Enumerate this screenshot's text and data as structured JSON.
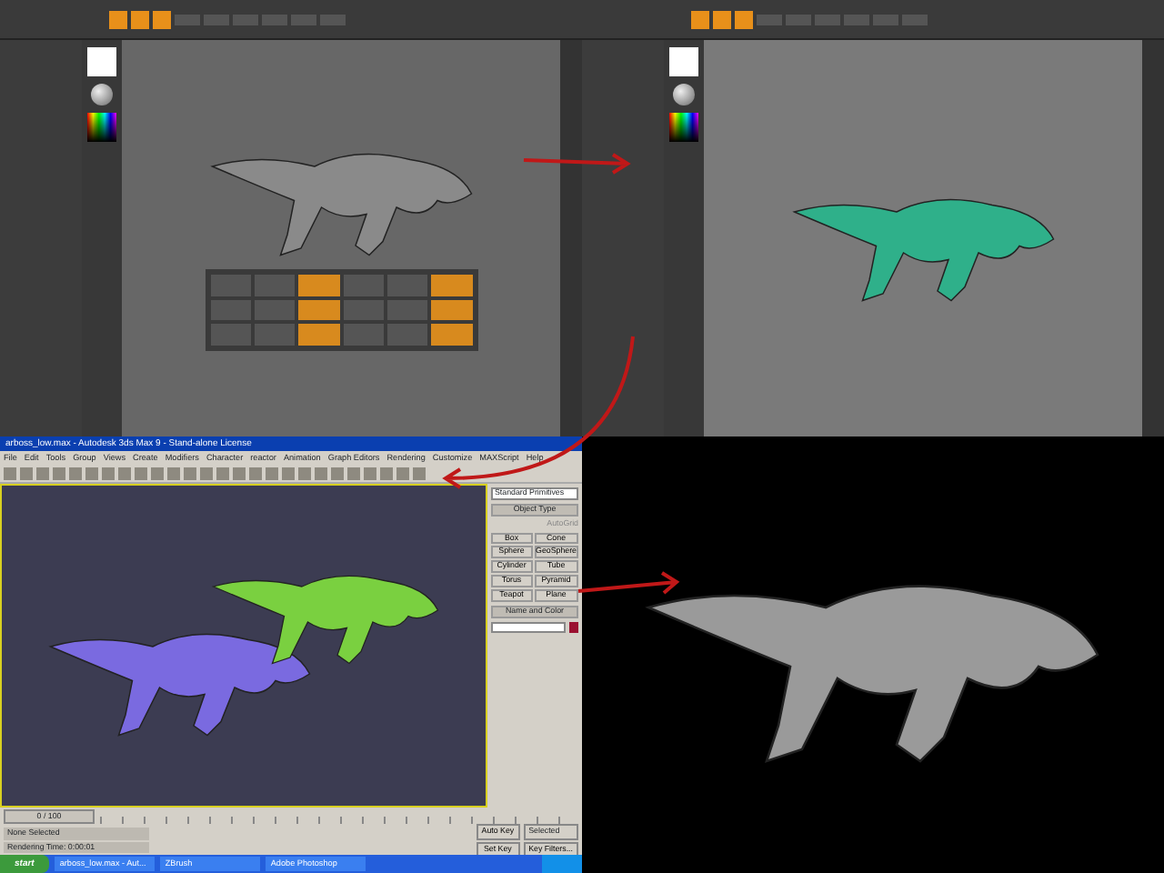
{
  "panels": [
    {
      "kind": "zbrush_sculpt"
    },
    {
      "kind": "zbrush_paint"
    },
    {
      "kind": "max",
      "title": "arboss_low.max - Autodesk 3ds Max 9 - Stand-alone License",
      "menu": [
        "File",
        "Edit",
        "Tools",
        "Group",
        "Views",
        "Create",
        "Modifiers",
        "Character",
        "reactor",
        "Animation",
        "Graph Editors",
        "Rendering",
        "Customize",
        "MAXScript",
        "Help"
      ],
      "command_panel": {
        "dropdown": "Standard Primitives",
        "section": "Object Type",
        "autogrid": "AutoGrid",
        "buttons": [
          "Box",
          "Cone",
          "Sphere",
          "GeoSphere",
          "Cylinder",
          "Tube",
          "Torus",
          "Pyramid",
          "Teapot",
          "Plane"
        ],
        "name_section": "Name and Color"
      },
      "timeline": {
        "label": "0 / 100"
      },
      "status": {
        "selection": "None Selected",
        "render_time": "Rendering Time: 0:00:01",
        "auto_key": "Auto Key",
        "key_mode": "Selected",
        "set_key": "Set Key",
        "key_filters": "Key Filters..."
      },
      "taskbar": {
        "start": "start",
        "tasks": [
          "arboss_low.max - Aut...",
          "ZBrush",
          "Adobe Photoshop"
        ]
      }
    },
    {
      "kind": "render"
    }
  ]
}
